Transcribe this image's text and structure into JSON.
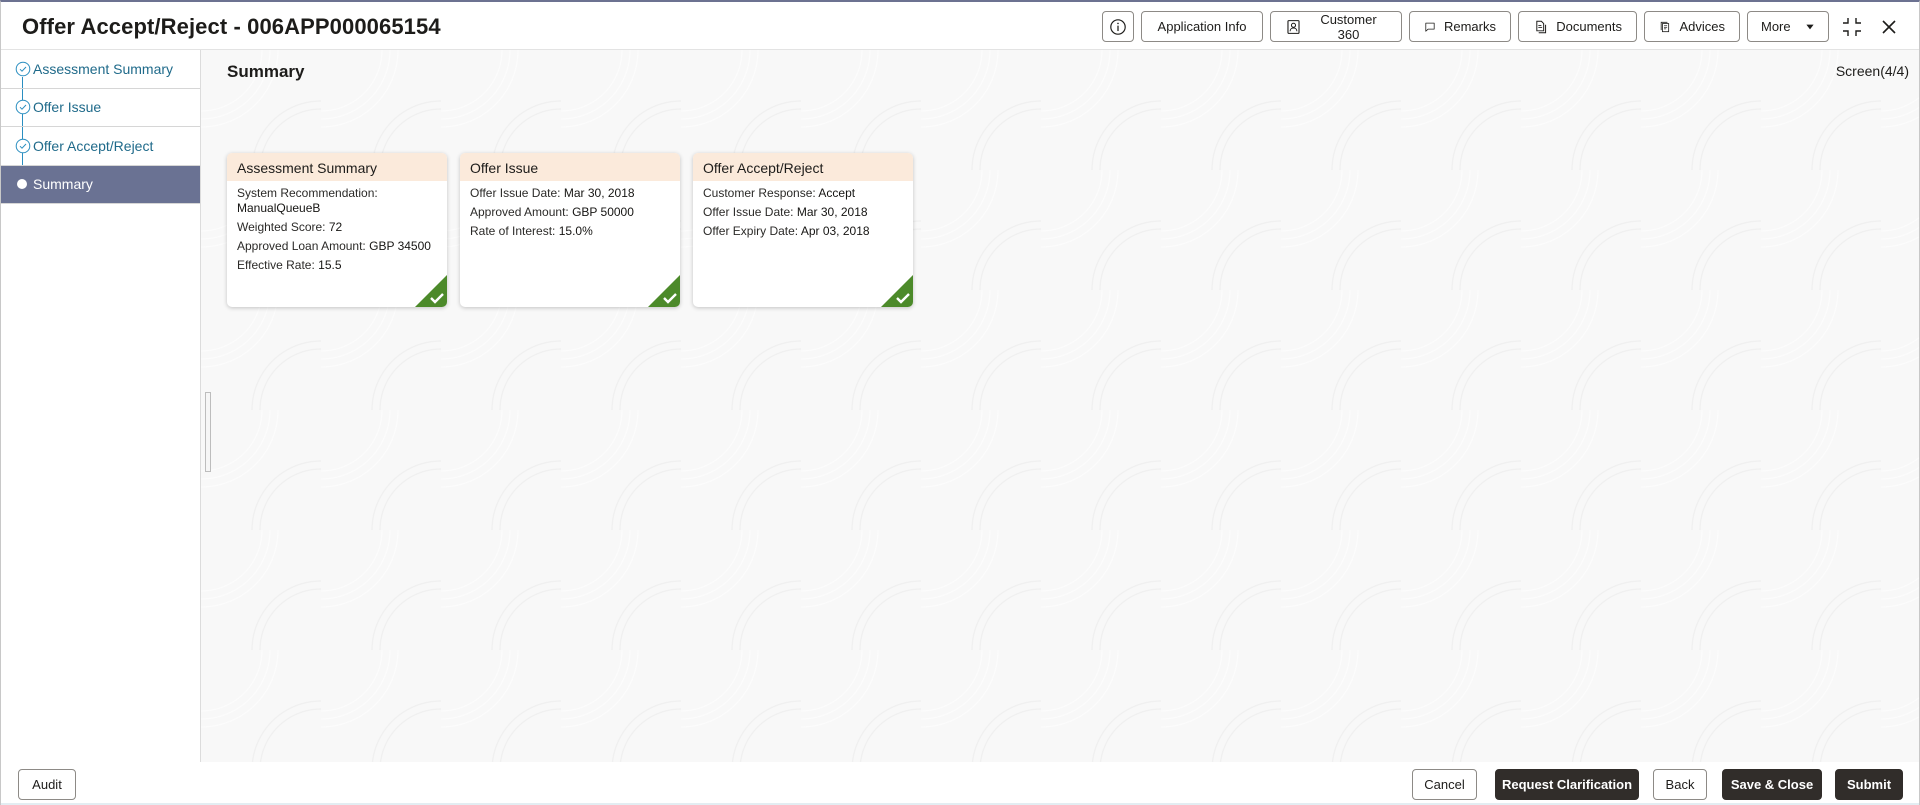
{
  "header": {
    "title": "Offer Accept/Reject - 006APP000065154",
    "toolbar": {
      "info_icon": "info-circle-icon",
      "application_info": "Application Info",
      "customer_360": "Customer 360",
      "remarks": "Remarks",
      "documents": "Documents",
      "advices": "Advices",
      "more": "More"
    }
  },
  "sidebar": {
    "items": [
      {
        "label": "Assessment Summary",
        "status": "completed"
      },
      {
        "label": "Offer Issue",
        "status": "completed"
      },
      {
        "label": "Offer Accept/Reject",
        "status": "completed"
      },
      {
        "label": "Summary",
        "status": "active"
      }
    ]
  },
  "main": {
    "title": "Summary",
    "screen_indicator": "Screen(4/4)",
    "cards": [
      {
        "title": "Assessment Summary",
        "fields": [
          {
            "label": "System Recommendation:",
            "value": "ManualQueueB"
          },
          {
            "label": "Weighted Score:",
            "value": "72"
          },
          {
            "label": "Approved Loan Amount:",
            "value": "GBP 34500"
          },
          {
            "label": "Effective Rate:",
            "value": "15.5"
          }
        ],
        "completed": true
      },
      {
        "title": "Offer Issue",
        "fields": [
          {
            "label": "Offer Issue Date:",
            "value": "Mar 30, 2018"
          },
          {
            "label": "Approved Amount:",
            "value": "GBP 50000"
          },
          {
            "label": "Rate of Interest:",
            "value": "15.0%"
          }
        ],
        "completed": true
      },
      {
        "title": "Offer Accept/Reject",
        "fields": [
          {
            "label": "Customer Response:",
            "value": "Accept"
          },
          {
            "label": "Offer Issue Date:",
            "value": "Mar 30, 2018"
          },
          {
            "label": "Offer Expiry Date:",
            "value": "Apr 03, 2018"
          }
        ],
        "completed": true
      }
    ]
  },
  "footer": {
    "audit": "Audit",
    "cancel": "Cancel",
    "request_clarification": "Request Clarification",
    "back": "Back",
    "save_close": "Save & Close",
    "submit": "Submit"
  },
  "colors": {
    "active_nav": "#6a7293",
    "link": "#1f6a8a",
    "card_header": "#fbeadb",
    "check_badge": "#4c8a2a",
    "primary_button": "#312d2a"
  }
}
